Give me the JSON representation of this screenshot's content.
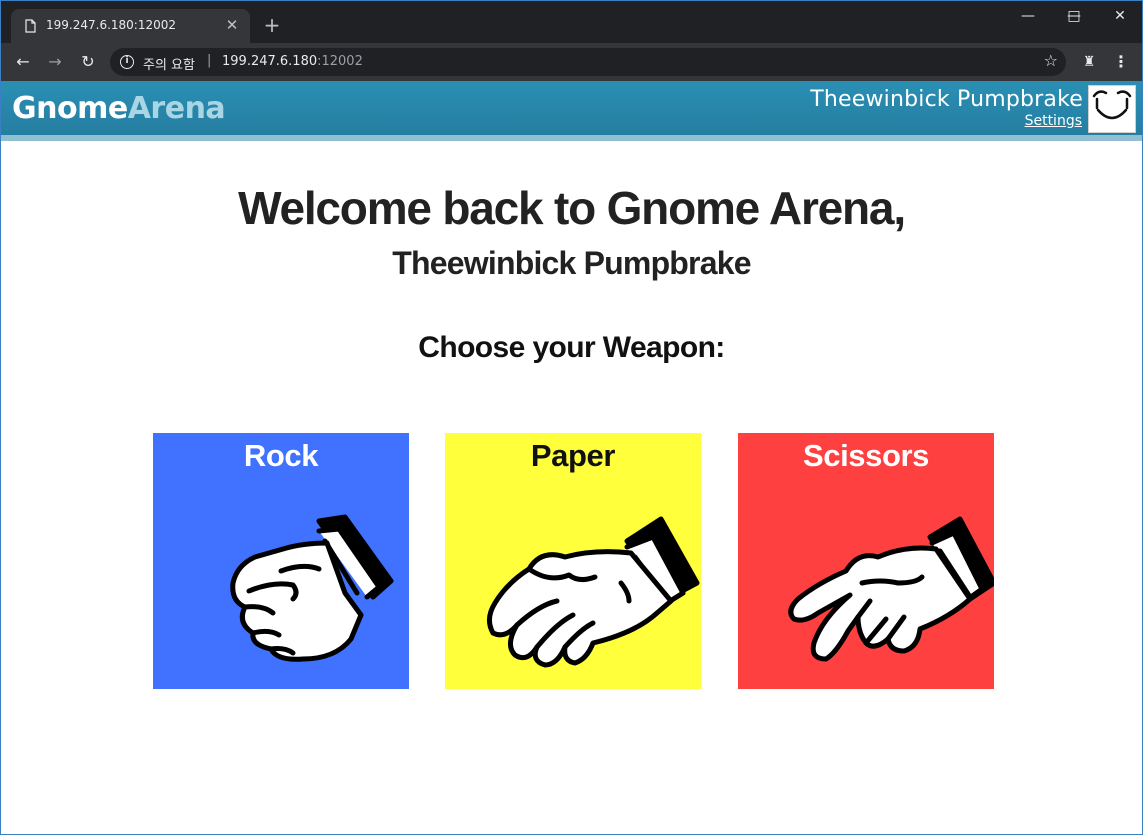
{
  "browser": {
    "tab_title": "199.247.6.180:12002",
    "security_label": "주의 요함",
    "url_host": "199.247.6.180",
    "url_port": ":12002"
  },
  "header": {
    "brand_part1": "Gnome",
    "brand_part2": "Arena",
    "user_name": "Theewinbick Pumpbrake",
    "settings_label": "Settings"
  },
  "main": {
    "welcome": "Welcome back to Gnome Arena,",
    "player_name": "Theewinbick Pumpbrake",
    "choose_heading": "Choose your Weapon:",
    "weapons": [
      {
        "label": "Rock",
        "color": "#4072ff",
        "icon": "fist-icon"
      },
      {
        "label": "Paper",
        "color": "#ffff3c",
        "icon": "open-hand-icon"
      },
      {
        "label": "Scissors",
        "color": "#ff4040",
        "icon": "two-fingers-icon"
      }
    ]
  }
}
